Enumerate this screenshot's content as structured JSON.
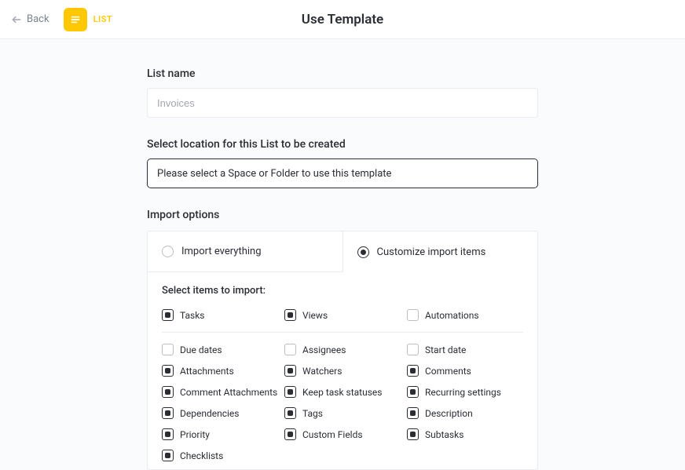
{
  "header": {
    "back_label": "Back",
    "tag_label": "LIST",
    "title": "Use Template"
  },
  "form": {
    "list_name_label": "List name",
    "list_name_placeholder": "Invoices",
    "location_label": "Select location for this List to be created",
    "location_placeholder": "Please select a Space or Folder to use this template"
  },
  "import": {
    "label": "Import options",
    "tab_everything": "Import everything",
    "tab_customize": "Customize import items",
    "subtitle": "Select items to import:",
    "primary": [
      {
        "label": "Tasks",
        "checked": true
      },
      {
        "label": "Views",
        "checked": true
      },
      {
        "label": "Automations",
        "checked": false
      }
    ],
    "secondary": [
      {
        "label": "Due dates",
        "checked": false
      },
      {
        "label": "Assignees",
        "checked": false
      },
      {
        "label": "Start date",
        "checked": false
      },
      {
        "label": "Attachments",
        "checked": true
      },
      {
        "label": "Watchers",
        "checked": true
      },
      {
        "label": "Comments",
        "checked": true
      },
      {
        "label": "Comment Attachments",
        "checked": true
      },
      {
        "label": "Keep task statuses",
        "checked": true
      },
      {
        "label": "Recurring settings",
        "checked": true
      },
      {
        "label": "Dependencies",
        "checked": true
      },
      {
        "label": "Tags",
        "checked": true
      },
      {
        "label": "Description",
        "checked": true
      },
      {
        "label": "Priority",
        "checked": true
      },
      {
        "label": "Custom Fields",
        "checked": true
      },
      {
        "label": "Subtasks",
        "checked": true
      },
      {
        "label": "Checklists",
        "checked": true
      }
    ]
  }
}
